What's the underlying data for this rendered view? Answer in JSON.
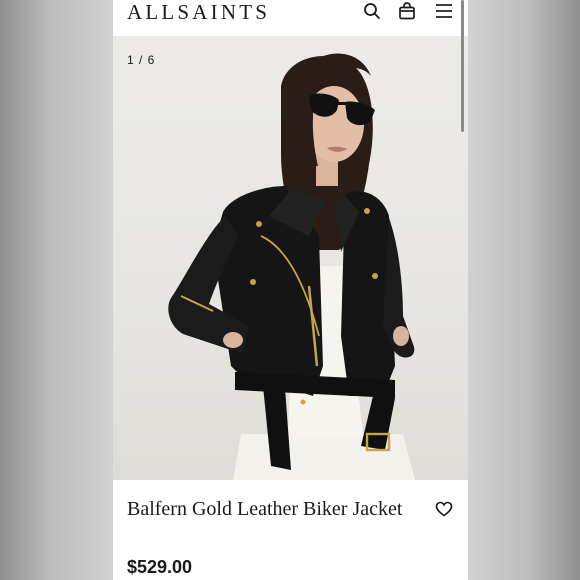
{
  "header": {
    "brand": "ALLSAINTS",
    "icons": [
      "search-icon",
      "bag-icon",
      "menu-icon"
    ]
  },
  "gallery": {
    "counter": "1 / 6",
    "current": 1,
    "total": 6
  },
  "product": {
    "title": "Balfern Gold Leather Biker Jacket",
    "price": "$529.00"
  },
  "colors": {
    "text": "#1a1a1a",
    "page_bg": "#ffffff",
    "backdrop": "#d2d2d2",
    "jacket": "#151515",
    "hardware_gold": "#c9a24b"
  }
}
